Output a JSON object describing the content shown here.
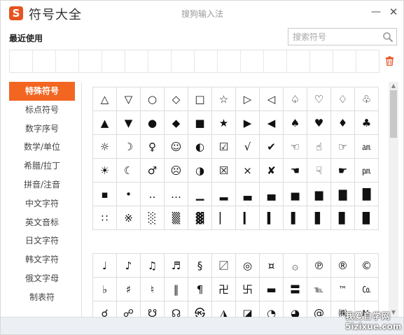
{
  "app": {
    "title": "符号大全",
    "subtitle": "搜狗输入法",
    "logo": "S",
    "minimize_glyph": "—",
    "close_glyph": "✕"
  },
  "recent": {
    "label": "最近使用",
    "cell_count": 16
  },
  "search": {
    "placeholder": "搜索符号"
  },
  "sidebar": {
    "items": [
      {
        "label": "特殊符号",
        "active": true
      },
      {
        "label": "标点符号",
        "active": false
      },
      {
        "label": "数字序号",
        "active": false
      },
      {
        "label": "数学/单位",
        "active": false
      },
      {
        "label": "希腊/拉丁",
        "active": false
      },
      {
        "label": "拼音/注音",
        "active": false
      },
      {
        "label": "中文字符",
        "active": false
      },
      {
        "label": "英文音标",
        "active": false
      },
      {
        "label": "日文字符",
        "active": false
      },
      {
        "label": "韩文字符",
        "active": false
      },
      {
        "label": "俄文字母",
        "active": false
      },
      {
        "label": "制表符",
        "active": false
      }
    ]
  },
  "grid1": [
    [
      "△",
      "▽",
      "○",
      "◇",
      "□",
      "☆",
      "▷",
      "◁",
      "♤",
      "♡",
      "♢",
      "♧"
    ],
    [
      "▲",
      "▼",
      "●",
      "◆",
      "■",
      "★",
      "▶",
      "◀",
      "♠",
      "♥",
      "♦",
      "♣"
    ],
    [
      "☼",
      "☽",
      "♀",
      "☺",
      "◐",
      "☑",
      "√",
      "✔",
      "☜",
      "☝",
      "☞",
      "㏂"
    ],
    [
      "☀",
      "☾",
      "♂",
      "☹",
      "◑",
      "☒",
      "×",
      "✘",
      "☚",
      "☟",
      "☛",
      "㏘"
    ],
    [
      "▪",
      "•",
      "‥",
      "…",
      "▁",
      "▂",
      "▃",
      "▄",
      "▅",
      "▆",
      "▇",
      "█"
    ],
    [
      "∷",
      "※",
      "░",
      "▒",
      "▓",
      "▏",
      "▎",
      "▍",
      "▌",
      "▋",
      "▊",
      "▉"
    ]
  ],
  "grid2": [
    [
      "♩",
      "♪",
      "♫",
      "♬",
      "§",
      "〼",
      "◎",
      "¤",
      "۞",
      "℗",
      "®",
      "©"
    ],
    [
      "♭",
      "♯",
      "♮",
      "‖",
      "¶",
      "卍",
      "卐",
      "▬",
      "〓",
      "℡",
      "™",
      "㏇"
    ],
    [
      "☌",
      "☍",
      "☋",
      "☊",
      "㉿",
      "◮",
      "◪",
      "◔",
      "◕",
      "@",
      "㈱",
      "№"
    ]
  ],
  "scrollbar": {
    "up": "▲",
    "down": "▼"
  },
  "watermark": {
    "line1": "我爱自学网",
    "line2": "5izixue.com"
  },
  "colors": {
    "accent": "#f26622",
    "logo": "#e5531f",
    "trash": "#e8592a"
  }
}
